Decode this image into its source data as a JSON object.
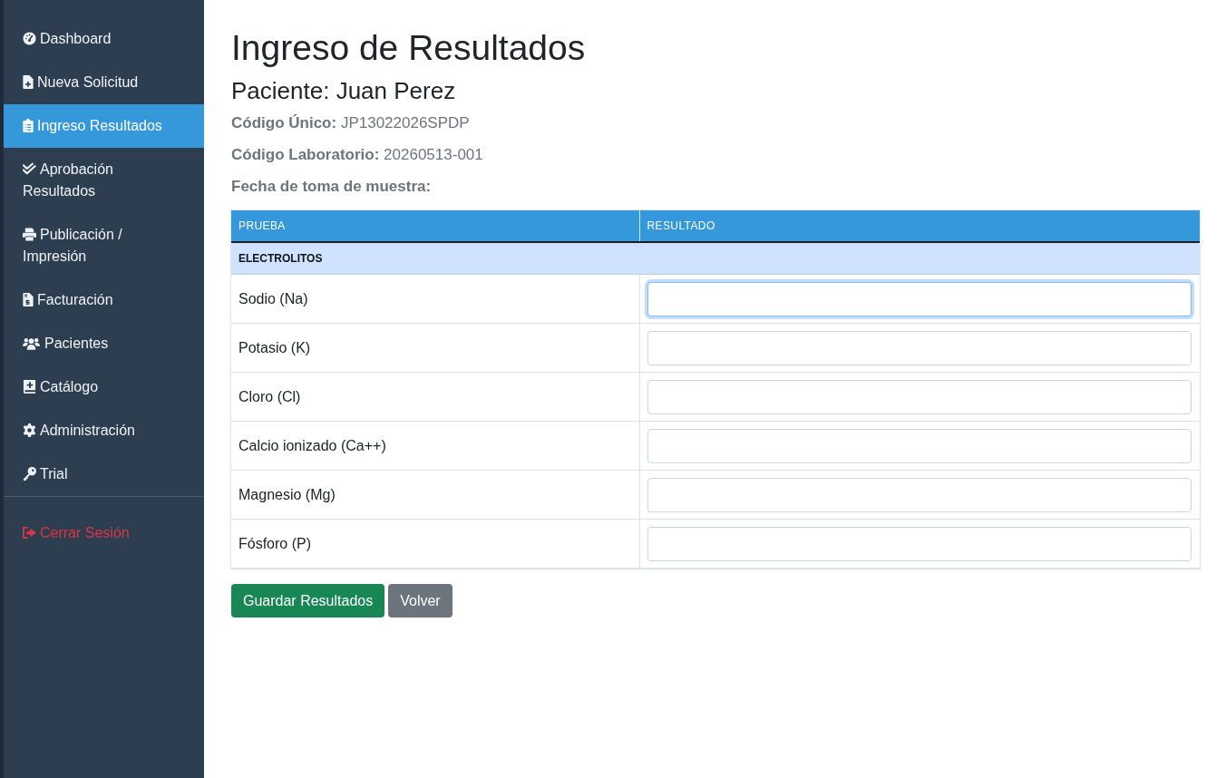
{
  "sidebar": {
    "items": [
      {
        "label": "Dashboard",
        "selected": false
      },
      {
        "label": "Nueva Solicitud",
        "selected": false
      },
      {
        "label": "Ingreso Resultados",
        "selected": true
      },
      {
        "label": "Aprobación Resultados",
        "selected": false
      },
      {
        "label": "Publicación / Impresión",
        "selected": false
      },
      {
        "label": "Facturación",
        "selected": false
      },
      {
        "label": "Pacientes",
        "selected": false
      },
      {
        "label": "Catálogo",
        "selected": false
      },
      {
        "label": "Administración",
        "selected": false
      },
      {
        "label": "Trial",
        "selected": false
      }
    ],
    "logout": {
      "label": "Cerrar Sesión"
    }
  },
  "page": {
    "title": "Ingreso de Resultados",
    "patient": "Paciente: Juan Perez",
    "details": [
      {
        "label": "Código Único:",
        "value": "JP13022026SPDP"
      },
      {
        "label": "Código Laboratorio:",
        "value": "20260513-001"
      },
      {
        "label": "Fecha de toma de muestra:"
      }
    ]
  },
  "table": {
    "columns": [
      "PRUEBA",
      "RESULTADO"
    ],
    "groups": [
      {
        "name": "ELECTROLITOS",
        "rows": [
          {
            "test": "Sodio (Na)",
            "focused": true
          },
          {
            "test": "Potasio (K)",
            "focused": false
          },
          {
            "test": "Cloro (Cl)",
            "focused": false
          },
          {
            "test": "Calcio ionizado (Ca++)",
            "focused": false
          },
          {
            "test": "Magnesio (Mg)",
            "focused": false
          },
          {
            "test": "Fósforo (P)",
            "focused": false
          }
        ]
      }
    ]
  },
  "buttons": [
    {
      "label": "Guardar Resultados",
      "kind": "primary"
    },
    {
      "label": "Volver",
      "kind": "secondary"
    }
  ]
}
